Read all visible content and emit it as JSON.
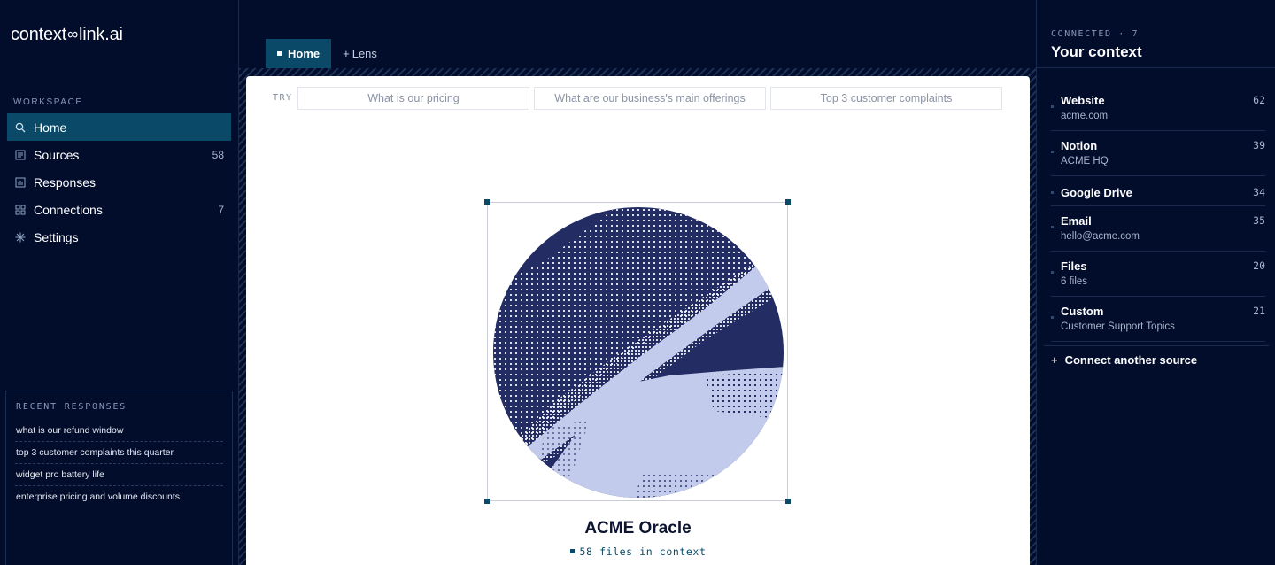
{
  "brand": {
    "left": "context",
    "symbol": "∞",
    "right": "link.ai"
  },
  "sidebar": {
    "section_label": "WORKSPACE",
    "items": [
      {
        "label": "Home",
        "icon": "search-icon",
        "count": ""
      },
      {
        "label": "Sources",
        "icon": "document-icon",
        "count": "58"
      },
      {
        "label": "Responses",
        "icon": "bar-chart-icon",
        "count": ""
      },
      {
        "label": "Connections",
        "icon": "grid-icon",
        "count": "7"
      },
      {
        "label": "Settings",
        "icon": "asterisk-icon",
        "count": ""
      }
    ],
    "recent_title": "RECENT RESPONSES",
    "recent": [
      "what is our refund window",
      "top 3 customer complaints this quarter",
      "widget pro battery life",
      "enterprise pricing and volume discounts"
    ]
  },
  "tabs": [
    {
      "label": "Home",
      "active": true
    },
    {
      "label": "Lens",
      "active": false
    }
  ],
  "try": {
    "label": "TRY",
    "suggestions": [
      "What is our pricing",
      "What are our business's main offerings",
      "Top 3 customer complaints"
    ]
  },
  "oracle": {
    "title": "ACME Oracle",
    "files": "58 files in context"
  },
  "context": {
    "label": "CONNECTED · 7",
    "title": "Your context",
    "sources": [
      {
        "name": "Website",
        "sub": "acme.com",
        "count": "62"
      },
      {
        "name": "Notion",
        "sub": "ACME HQ",
        "count": "39"
      },
      {
        "name": "Google Drive",
        "sub": "",
        "count": "34"
      },
      {
        "name": "Email",
        "sub": "hello@acme.com",
        "count": "35"
      },
      {
        "name": "Files",
        "sub": "6 files",
        "count": "20"
      },
      {
        "name": "Custom",
        "sub": "Customer Support Topics",
        "count": "21"
      }
    ],
    "connect_label": "Connect another source"
  },
  "colors": {
    "background": "#020c2b",
    "accent": "#0a4a68",
    "orb_dark": "#232d64",
    "orb_light": "#c3cbed"
  }
}
